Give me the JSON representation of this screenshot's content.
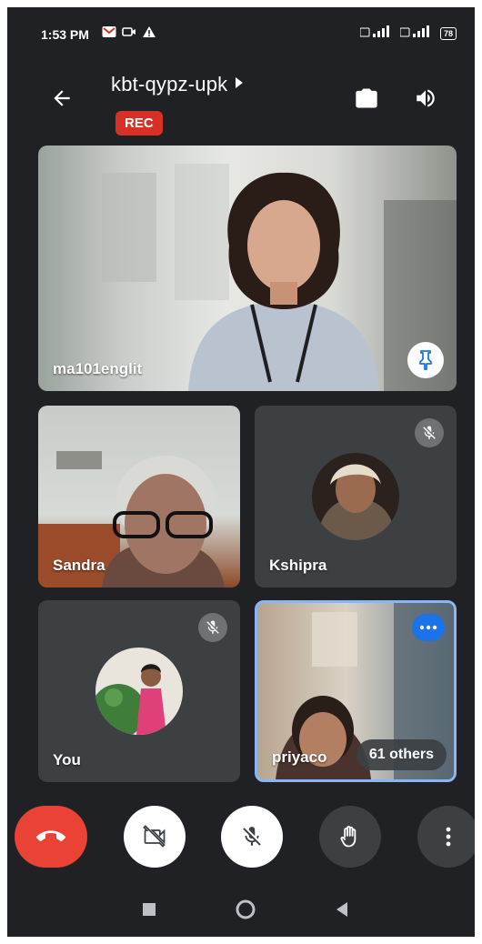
{
  "status_bar": {
    "time": "1:53 PM",
    "battery": "78"
  },
  "header": {
    "meeting_code": "kbt-qypz-upk",
    "rec_label": "REC"
  },
  "tiles": [
    {
      "name": "ma101englit",
      "pinned": false
    },
    {
      "name": "Sandra",
      "muted": false
    },
    {
      "name": "Kshipra",
      "muted": true
    },
    {
      "name": "You",
      "muted": true
    },
    {
      "name": "priyaco",
      "muted": false
    }
  ],
  "others_label": "61 others",
  "controls": [
    {
      "icon": "end-call-icon",
      "color": "#ea4335"
    },
    {
      "icon": "camera-off-icon",
      "color": "#ffffff"
    },
    {
      "icon": "mic-off-icon",
      "color": "#ffffff"
    },
    {
      "icon": "raise-hand-icon",
      "color": "#3c4043"
    },
    {
      "icon": "more-options-icon",
      "color": "#3c4043"
    }
  ],
  "colors": {
    "background": "#202124",
    "tile": "#3c4043",
    "accent": "#8ab4f8",
    "rec": "#d93025"
  }
}
